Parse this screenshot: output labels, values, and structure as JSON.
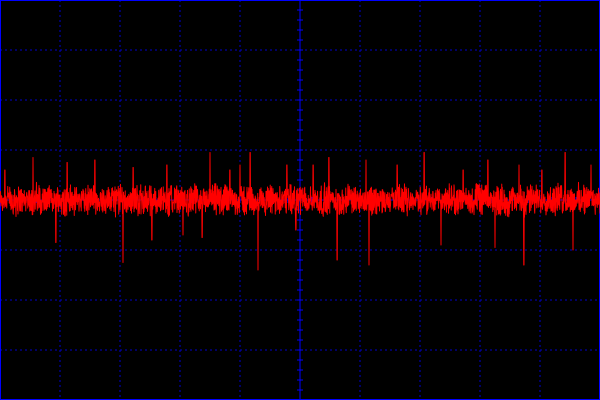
{
  "chart_data": {
    "type": "line",
    "title": "",
    "xlabel": "",
    "ylabel": "",
    "grid": true,
    "x_divisions": 10,
    "y_divisions": 8,
    "xlim": [
      0,
      10
    ],
    "ylim": [
      -4,
      4
    ],
    "series": [
      {
        "color": "#ff0000",
        "noise_amplitude": 0.25,
        "baseline": 0,
        "spikes": [
          {
            "x": 0.08,
            "y": 0.6
          },
          {
            "x": 0.55,
            "y": 0.85
          },
          {
            "x": 0.93,
            "y": -0.85
          },
          {
            "x": 1.12,
            "y": 0.75
          },
          {
            "x": 1.58,
            "y": 0.8
          },
          {
            "x": 2.05,
            "y": -1.25
          },
          {
            "x": 2.22,
            "y": 0.65
          },
          {
            "x": 2.53,
            "y": -0.8
          },
          {
            "x": 2.78,
            "y": 0.7
          },
          {
            "x": 3.05,
            "y": -0.7
          },
          {
            "x": 3.37,
            "y": -0.75
          },
          {
            "x": 3.5,
            "y": 0.95
          },
          {
            "x": 3.83,
            "y": 0.6
          },
          {
            "x": 4.0,
            "y": 0.7
          },
          {
            "x": 4.17,
            "y": 0.95
          },
          {
            "x": 4.3,
            "y": -1.4
          },
          {
            "x": 4.78,
            "y": 0.7
          },
          {
            "x": 4.93,
            "y": -0.6
          },
          {
            "x": 5.22,
            "y": 0.7
          },
          {
            "x": 5.48,
            "y": 0.85
          },
          {
            "x": 5.62,
            "y": -1.2
          },
          {
            "x": 6.1,
            "y": 0.8
          },
          {
            "x": 6.15,
            "y": -1.3
          },
          {
            "x": 6.62,
            "y": 0.7
          },
          {
            "x": 7.07,
            "y": 0.95
          },
          {
            "x": 7.35,
            "y": -0.9
          },
          {
            "x": 7.72,
            "y": 0.6
          },
          {
            "x": 8.13,
            "y": 0.8
          },
          {
            "x": 8.25,
            "y": -0.95
          },
          {
            "x": 8.65,
            "y": 0.7
          },
          {
            "x": 8.73,
            "y": -1.3
          },
          {
            "x": 9.03,
            "y": 0.6
          },
          {
            "x": 9.42,
            "y": 0.95
          },
          {
            "x": 9.55,
            "y": -1.0
          },
          {
            "x": 9.85,
            "y": 0.7
          }
        ]
      }
    ],
    "colors": {
      "background": "#000000",
      "grid_major": "#0000ff",
      "grid_minor": "#0000cc",
      "trace": "#ff0000"
    }
  }
}
